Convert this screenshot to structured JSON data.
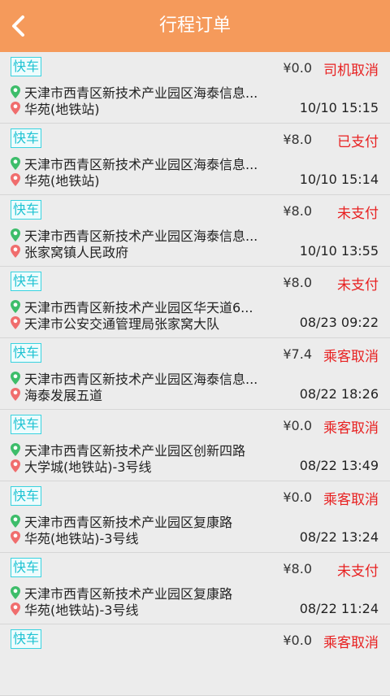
{
  "header": {
    "title": "行程订单",
    "back_icon": "back-arrow-icon"
  },
  "colors": {
    "header_bg": "#f59a5b",
    "tag": "#1fc3d3",
    "pin_origin": "#3dbd6a",
    "pin_dest": "#f06d6d",
    "status_red": "#e82121"
  },
  "orders": [
    {
      "tag": "快车",
      "price": "¥0.0",
      "status": "司机取消",
      "from": "天津市西青区新技术产业园区海泰信息...",
      "to": "华苑(地铁站)",
      "time": "10/10 15:15"
    },
    {
      "tag": "快车",
      "price": "¥8.0",
      "status": "已支付",
      "from": "天津市西青区新技术产业园区海泰信息...",
      "to": "华苑(地铁站)",
      "time": "10/10 15:14"
    },
    {
      "tag": "快车",
      "price": "¥8.0",
      "status": "未支付",
      "from": "天津市西青区新技术产业园区海泰信息...",
      "to": "张家窝镇人民政府",
      "time": "10/10 13:55"
    },
    {
      "tag": "快车",
      "price": "¥8.0",
      "status": "未支付",
      "from": "天津市西青区新技术产业园区华天道6...",
      "to": "天津市公安交通管理局张家窝大队",
      "time": "08/23 09:22"
    },
    {
      "tag": "快车",
      "price": "¥7.4",
      "status": "乘客取消",
      "from": "天津市西青区新技术产业园区海泰信息...",
      "to": "海泰发展五道",
      "time": "08/22 18:26"
    },
    {
      "tag": "快车",
      "price": "¥0.0",
      "status": "乘客取消",
      "from": "天津市西青区新技术产业园区创新四路",
      "to": "大学城(地铁站)-3号线",
      "time": "08/22 13:49"
    },
    {
      "tag": "快车",
      "price": "¥0.0",
      "status": "乘客取消",
      "from": "天津市西青区新技术产业园区复康路",
      "to": "华苑(地铁站)-3号线",
      "time": "08/22 13:24"
    },
    {
      "tag": "快车",
      "price": "¥8.0",
      "status": "未支付",
      "from": "天津市西青区新技术产业园区复康路",
      "to": "华苑(地铁站)-3号线",
      "time": "08/22 11:24"
    },
    {
      "tag": "快车",
      "price": "¥0.0",
      "status": "乘客取消",
      "from": "",
      "to": "",
      "time": ""
    }
  ]
}
